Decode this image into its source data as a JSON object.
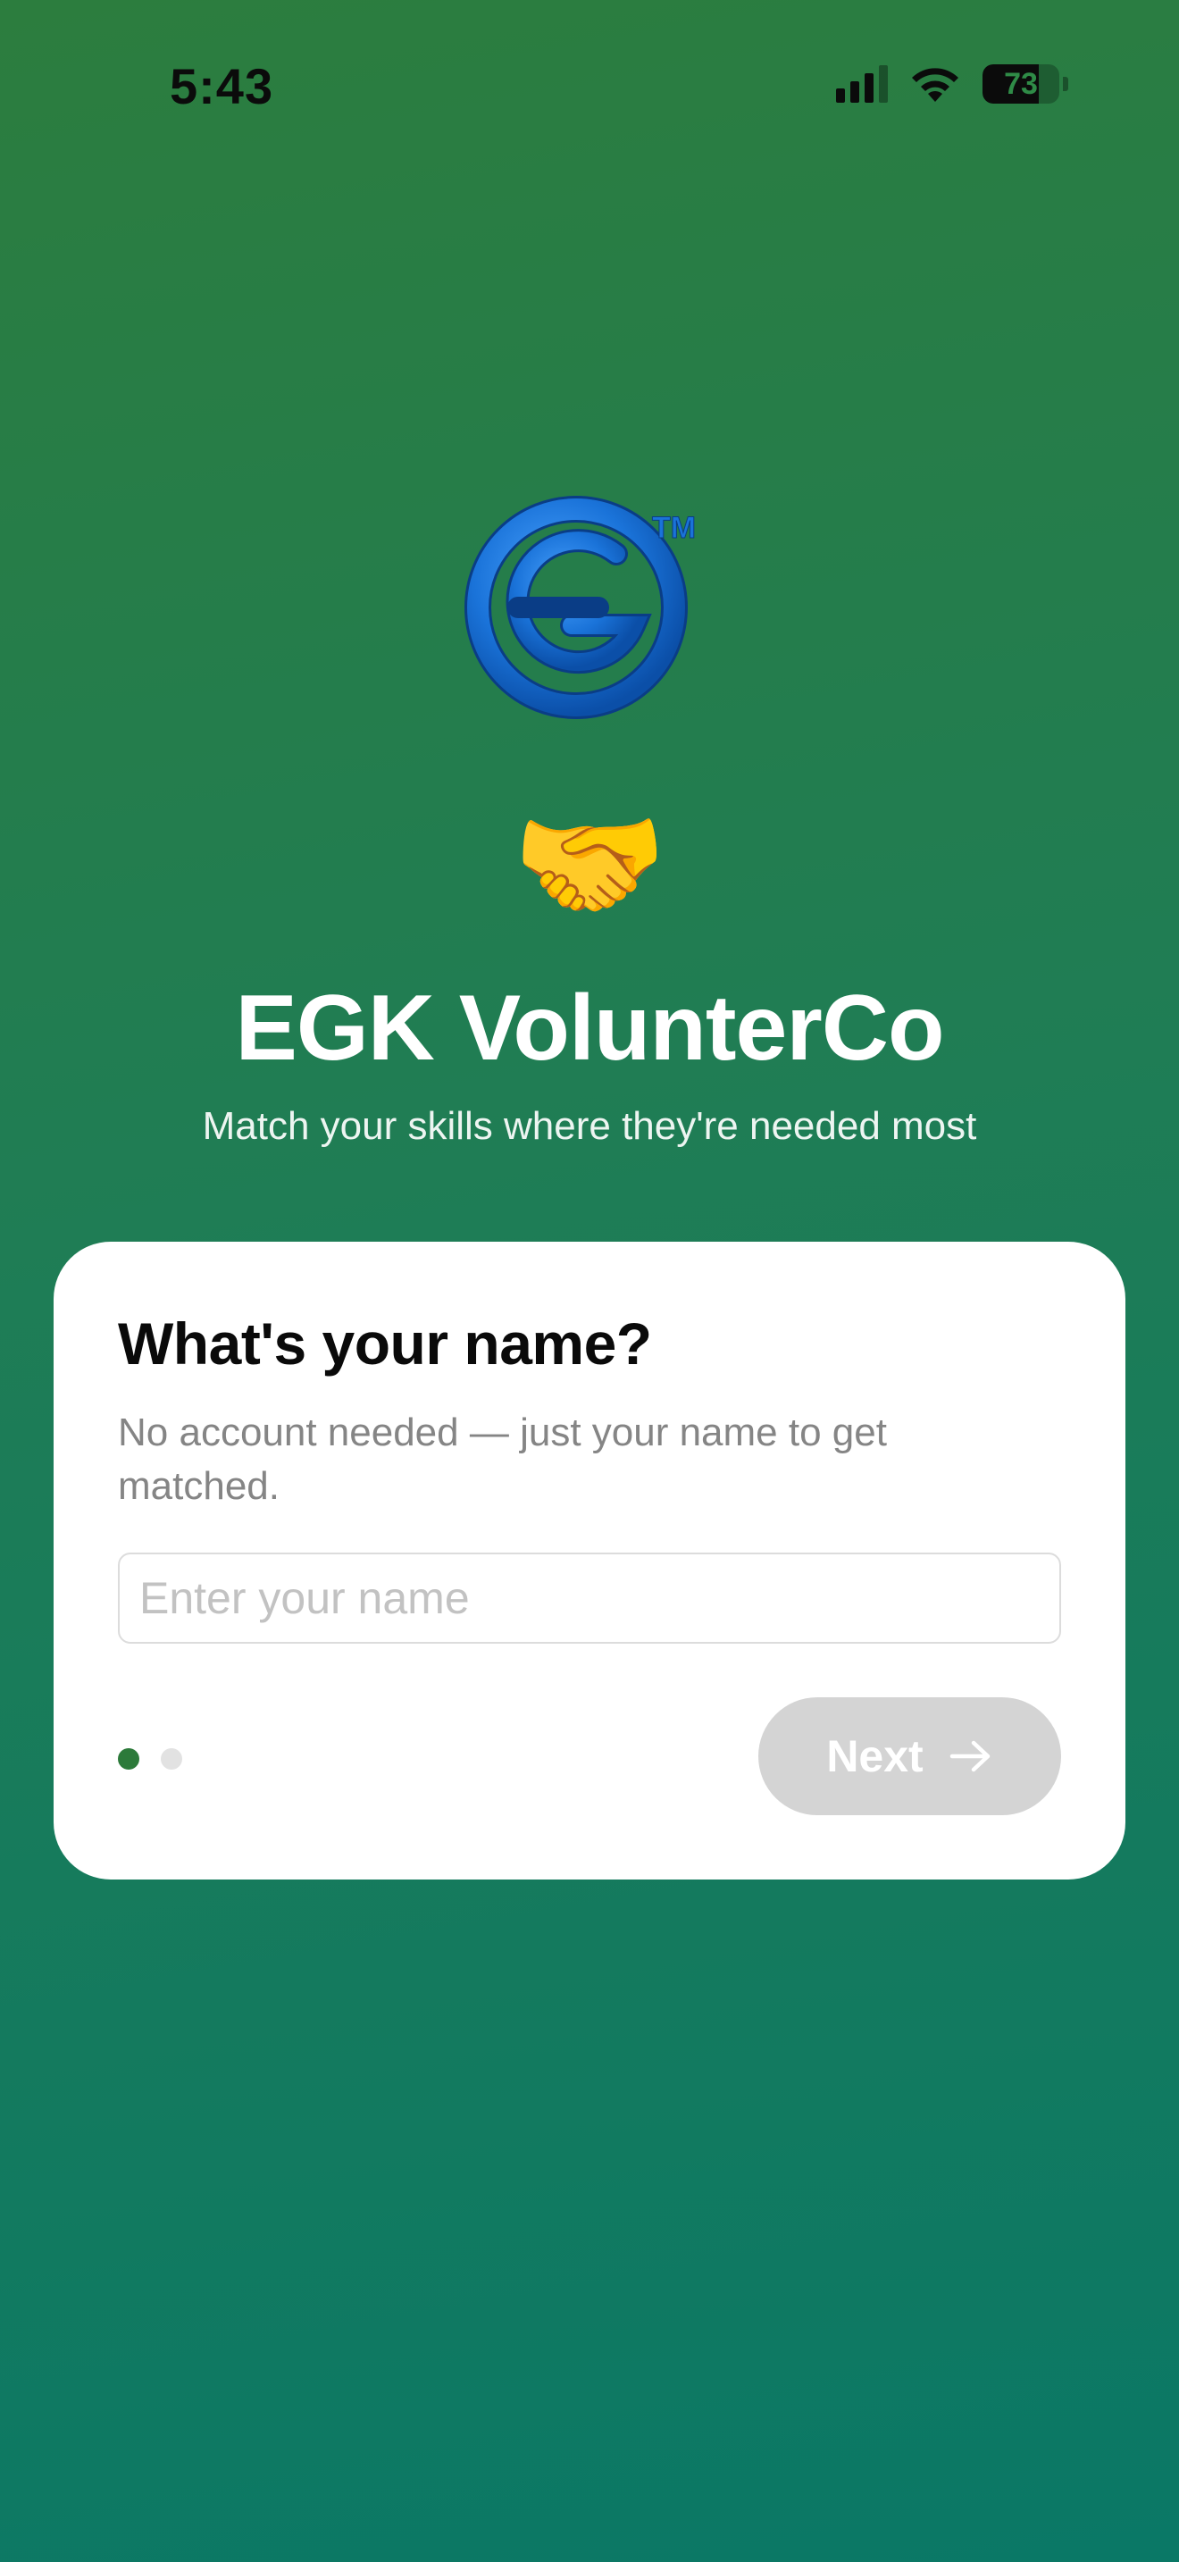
{
  "status_bar": {
    "time": "5:43",
    "battery_level": "73",
    "battery_fraction": 0.73,
    "signal_icon": "cellular-signal-icon",
    "wifi_icon": "wifi-icon"
  },
  "hero": {
    "logo_icon": "egk-logo",
    "logo_mark": "TM",
    "emoji": "🤝",
    "title": "EGK VolunterCo",
    "subtitle": "Match your skills where they're needed most"
  },
  "card": {
    "title": "What's your name?",
    "description": "No account needed — just your name to get matched.",
    "input": {
      "placeholder": "Enter your name",
      "value": ""
    },
    "pager": {
      "current_page": 1,
      "total_pages": 2
    },
    "next_button": {
      "label": "Next",
      "icon": "arrow-right-icon"
    }
  },
  "colors": {
    "background_top": "#2c7d3e",
    "background_bottom": "#0a7866",
    "accent": "#2c7a3a",
    "disabled_button": "#d4d4d4",
    "logo_blue": "#1a73d9"
  }
}
